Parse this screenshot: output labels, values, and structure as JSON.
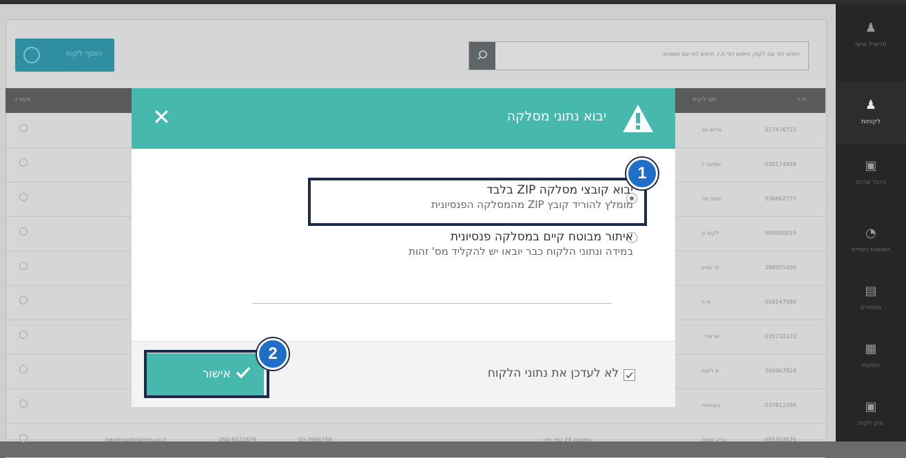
{
  "background": {
    "add_button_label": "הוסף לקוח",
    "search_placeholder": "חיפוש לפי שם לקוח, חיפוש לפי ת.ז, חיפוש לפי שם משפחה",
    "columns": [
      "ת.ז",
      "שם לקוח",
      "מעודה"
    ],
    "rows": [
      {
        "id": "027476723",
        "name": "אדיש חב"
      },
      {
        "id": "038174459",
        "name": "שמעה כ"
      },
      {
        "id": "036662773",
        "name": "מעוז טה"
      },
      {
        "id": "000000019",
        "name": "לקוח ט"
      },
      {
        "id": "308955400",
        "name": "חי שמע"
      },
      {
        "id": "056147580",
        "name": "ח ח"
      },
      {
        "id": "035732122",
        "name": "ישראלי י"
      },
      {
        "id": "300967924",
        "name": "ת לקוח"
      },
      {
        "id": "037812294",
        "name": "בעומחה"
      },
      {
        "id": "055303575",
        "name": "ברק אבנה",
        "email": "barakga@clal-ins.co.il",
        "phone1": "050-8222879",
        "phone2": "03-7966758",
        "address": "המפונה 24 כפר חיה"
      }
    ]
  },
  "sidebar": {
    "items": [
      {
        "label": "פרופיל אישי",
        "icon": "user-icon"
      },
      {
        "label": "לקוחות",
        "icon": "clients-icon"
      },
      {
        "label": "ניהול ארכה",
        "icon": "chart-icon"
      },
      {
        "label": "השוואת כיסויים",
        "icon": "gauge-icon"
      },
      {
        "label": "מסמכים",
        "icon": "documents-icon"
      },
      {
        "label": "הפקות",
        "icon": "report-icon"
      },
      {
        "label": "תיק לקוח",
        "icon": "folder-icon"
      }
    ]
  },
  "modal": {
    "title": "יבוא נתוני מסלקה",
    "options": [
      {
        "title": "יבוא קובצי מסלקה ZIP בלבד",
        "subtitle": "מומלץ להוריד קובץ ZIP מהמסלקה הפנסיונית",
        "selected": true
      },
      {
        "title": "איתור מבוטח קיים במסלקה פנסיונית",
        "subtitle": "במידה ונתוני הלקוח כבר יובאו יש להקליד מס' זהות",
        "selected": false
      }
    ],
    "checkbox_label": "לא לעדכן את נתוני הלקוח",
    "checkbox_checked": true,
    "confirm_label": "אישור"
  },
  "annotations": {
    "badge1": "1",
    "badge2": "2"
  },
  "colors": {
    "accent": "#46b8ad",
    "highlight_border": "#1d2b4a",
    "badge": "#1f6fc8"
  }
}
